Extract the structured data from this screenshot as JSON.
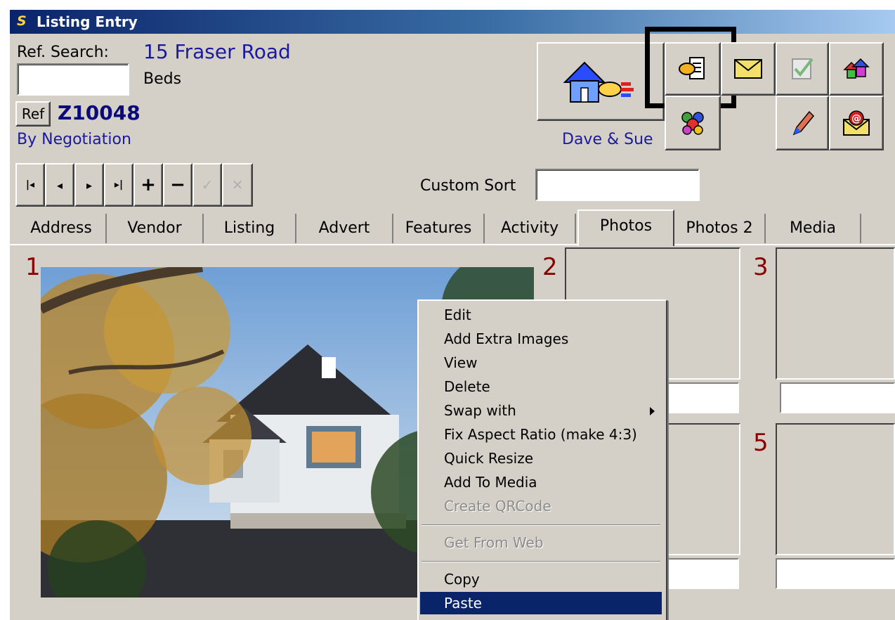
{
  "window": {
    "title": "Listing Entry",
    "icon_letter": "S"
  },
  "header": {
    "ref_search_label": "Ref. Search:",
    "ref_search_value": "",
    "address": "15 Fraser Road",
    "beds_label": "Beds",
    "ref_button": "Ref",
    "ref_code": "Z10048",
    "price": "By Negotiation",
    "agents": "Dave & Sue",
    "custom_sort_label": "Custom Sort",
    "custom_sort_value": ""
  },
  "nav_buttons": [
    "|◂",
    "◂",
    "▸",
    "▸|",
    "+",
    "−",
    "✓",
    "✕"
  ],
  "toolbar_icons": [
    "house-pointer-icon",
    "document-hand-icon",
    "envelope-icon",
    "todo-check-icon",
    "houses-icon",
    "people-group-icon",
    "pen-icon",
    "email-at-icon"
  ],
  "tabs": [
    "Address",
    "Vendor",
    "Listing",
    "Advert",
    "Features",
    "Activity",
    "Photos",
    "Photos 2",
    "Media"
  ],
  "active_tab": "Photos",
  "photos": {
    "labels": [
      "1",
      "2",
      "3",
      "5"
    ]
  },
  "context_menu": {
    "items": [
      {
        "label": "Edit",
        "state": "enabled"
      },
      {
        "label": "Add Extra Images",
        "state": "enabled"
      },
      {
        "label": "View",
        "state": "enabled"
      },
      {
        "label": "Delete",
        "state": "enabled"
      },
      {
        "label": "Swap with",
        "state": "submenu"
      },
      {
        "label": "Fix Aspect Ratio (make 4:3)",
        "state": "enabled"
      },
      {
        "label": "Quick Resize",
        "state": "enabled"
      },
      {
        "label": "Add To Media",
        "state": "enabled"
      },
      {
        "label": "Create QRCode",
        "state": "disabled"
      },
      {
        "label": "Get From Web",
        "state": "disabled"
      },
      {
        "label": "Copy",
        "state": "enabled"
      },
      {
        "label": "Paste",
        "state": "selected"
      }
    ]
  },
  "colors": {
    "titlebar": "#0a246a",
    "face": "#d4d0c8",
    "photo_number": "#8b0000",
    "link_blue": "#1a1a9e"
  }
}
